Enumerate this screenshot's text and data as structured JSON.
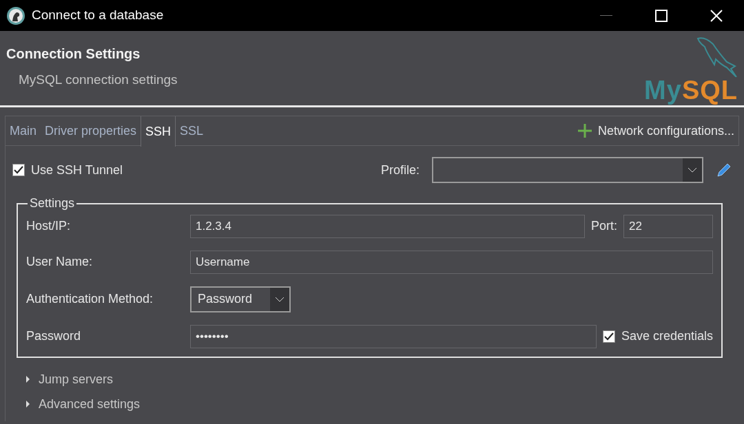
{
  "window": {
    "title": "Connect to a database"
  },
  "header": {
    "title": "Connection Settings",
    "subtitle": "MySQL connection settings",
    "logo": {
      "brand_a": "My",
      "brand_b": "SQL"
    }
  },
  "tabs": [
    {
      "label": "Main",
      "selected": false
    },
    {
      "label": "Driver properties",
      "selected": false
    },
    {
      "label": "SSH",
      "selected": true
    },
    {
      "label": "SSL",
      "selected": false
    }
  ],
  "network_button": {
    "label": "Network configurations..."
  },
  "use_ssh_tunnel": {
    "label": "Use SSH Tunnel",
    "checked": true
  },
  "profile": {
    "label": "Profile:"
  },
  "settings": {
    "legend": "Settings",
    "host": {
      "label": "Host/IP:",
      "value": "1.2.3.4"
    },
    "port": {
      "label": "Port:",
      "value": "22"
    },
    "user": {
      "label": "User Name:",
      "value": "Username"
    },
    "auth": {
      "label": "Authentication Method:",
      "value": "Password"
    },
    "password": {
      "label": "Password",
      "value": "••••••••"
    },
    "save_credentials": {
      "label": "Save credentials",
      "checked": true
    }
  },
  "sections": [
    {
      "label": "Jump servers",
      "expanded": false
    },
    {
      "label": "Advanced settings",
      "expanded": false
    }
  ]
}
